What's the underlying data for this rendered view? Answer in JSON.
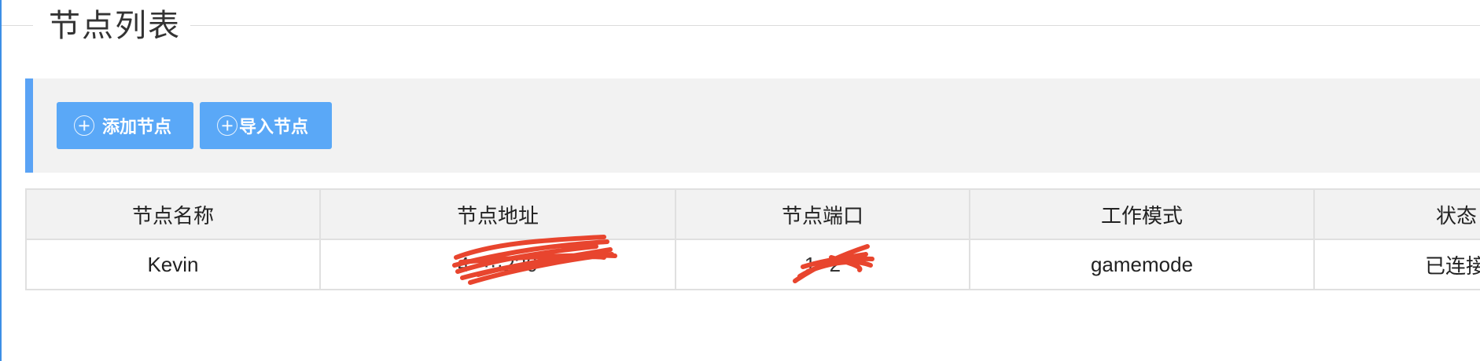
{
  "page": {
    "title": "节点列表"
  },
  "toolbar": {
    "add_button_label": "添加节点",
    "add_button_icon": "plus-circle-icon",
    "import_button_label": "导入节点",
    "import_button_icon": "plus-circle-icon",
    "accent_color": "#5aa3f5",
    "button_color": "#5aa8f7"
  },
  "table": {
    "columns": [
      "节点名称",
      "节点地址",
      "节点端口",
      "工作模式",
      "状态"
    ],
    "rows": [
      {
        "name": "Kevin",
        "address": "4·····230",
        "port": "1··2",
        "mode": "gamemode",
        "status": "已连接"
      }
    ]
  },
  "colors": {
    "redaction": "#e8452e",
    "header_bg": "#f2f2f2",
    "border": "#e0e0e0"
  }
}
